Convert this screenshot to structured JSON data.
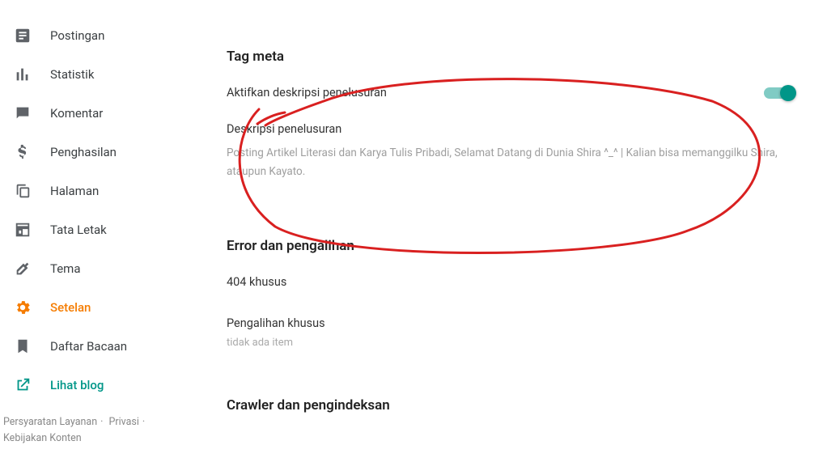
{
  "sidebar": {
    "items": [
      {
        "label": "Postingan"
      },
      {
        "label": "Statistik"
      },
      {
        "label": "Komentar"
      },
      {
        "label": "Penghasilan"
      },
      {
        "label": "Halaman"
      },
      {
        "label": "Tata Letak"
      },
      {
        "label": "Tema"
      },
      {
        "label": "Setelan"
      },
      {
        "label": "Daftar Bacaan"
      }
    ],
    "view_blog": "Lihat blog",
    "footer": {
      "terms": "Persyaratan Layanan",
      "privacy": "Privasi",
      "content_policy": "Kebijakan Konten"
    }
  },
  "main": {
    "section1": {
      "title": "Tag meta",
      "toggle_label": "Aktifkan deskripsi penelusuran",
      "toggle_state": true,
      "desc_label": "Deskripsi penelusuran",
      "desc_text": "Posting Artikel Literasi dan Karya Tulis Pribadi, Selamat Datang di Dunia Shira ^_^ | Kalian bisa memanggilku Shira, ataupun Kayato."
    },
    "section2": {
      "title": "Error dan pengalihan",
      "r1": "404 khusus",
      "r2": "Pengalihan khusus",
      "r2_note": "tidak ada item"
    },
    "section3": {
      "title": "Crawler dan pengindeksan"
    }
  }
}
